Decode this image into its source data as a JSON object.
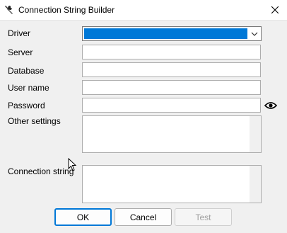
{
  "window": {
    "title": "Connection String Builder",
    "app_icon": "wrench-hammer-icon",
    "close_icon": "close-icon"
  },
  "form": {
    "driver": {
      "label": "Driver",
      "value": "",
      "selection_color": "#0078d7"
    },
    "server": {
      "label": "Server",
      "value": ""
    },
    "database": {
      "label": "Database",
      "value": ""
    },
    "user_name": {
      "label": "User name",
      "value": ""
    },
    "password": {
      "label": "Password",
      "value": "",
      "reveal_icon": "eye-icon"
    },
    "other_settings": {
      "label": "Other settings",
      "value": ""
    },
    "connection_string": {
      "label": "Connection string",
      "value": ""
    }
  },
  "buttons": {
    "ok": "OK",
    "cancel": "Cancel",
    "test": "Test"
  },
  "colors": {
    "accent": "#0078d7",
    "disabled_text": "#a0a0a0"
  }
}
